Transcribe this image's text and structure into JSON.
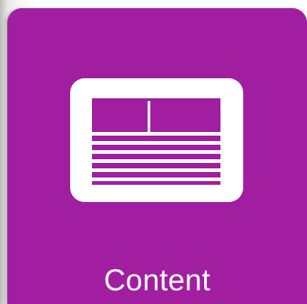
{
  "tile": {
    "label": "Content",
    "icon": "content-layout-icon",
    "background_color": "#a11ea1",
    "foreground_color": "#ffffff"
  }
}
